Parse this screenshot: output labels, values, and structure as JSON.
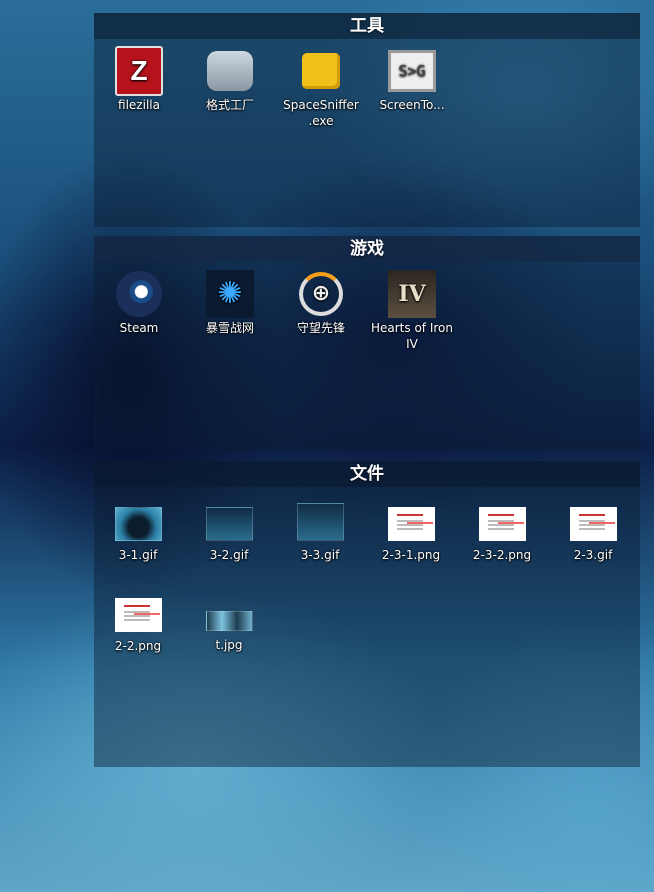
{
  "fences": [
    {
      "title": "工具",
      "items": [
        {
          "label": "filezilla",
          "icon": "filezilla-icon"
        },
        {
          "label": "格式工厂",
          "icon": "format-factory-icon"
        },
        {
          "label": "SpaceSniffer\n.exe",
          "icon": "spacesniffer-puzzle-icon"
        },
        {
          "label": "ScreenTo...",
          "icon": "screentogif-icon",
          "icon_text": "S>G"
        }
      ]
    },
    {
      "title": "游戏",
      "items": [
        {
          "label": "Steam",
          "icon": "steam-icon"
        },
        {
          "label": "暴雪战网",
          "icon": "battlenet-icon"
        },
        {
          "label": "守望先锋",
          "icon": "overwatch-icon"
        },
        {
          "label": "Hearts of Iron IV",
          "icon": "hoi4-icon",
          "icon_text": "IV"
        }
      ]
    },
    {
      "title": "文件",
      "items": [
        {
          "label": "3-1.gif",
          "icon": "gif-thumbnail"
        },
        {
          "label": "3-2.gif",
          "icon": "gif-thumbnail"
        },
        {
          "label": "3-3.gif",
          "icon": "gif-thumbnail"
        },
        {
          "label": "2-3-1.png",
          "icon": "png-thumbnail"
        },
        {
          "label": "2-3-2.png",
          "icon": "png-thumbnail"
        },
        {
          "label": "2-3.gif",
          "icon": "gif-thumbnail"
        },
        {
          "label": "2-2.png",
          "icon": "png-thumbnail"
        },
        {
          "label": "t.jpg",
          "icon": "jpg-thumbnail"
        }
      ]
    }
  ]
}
